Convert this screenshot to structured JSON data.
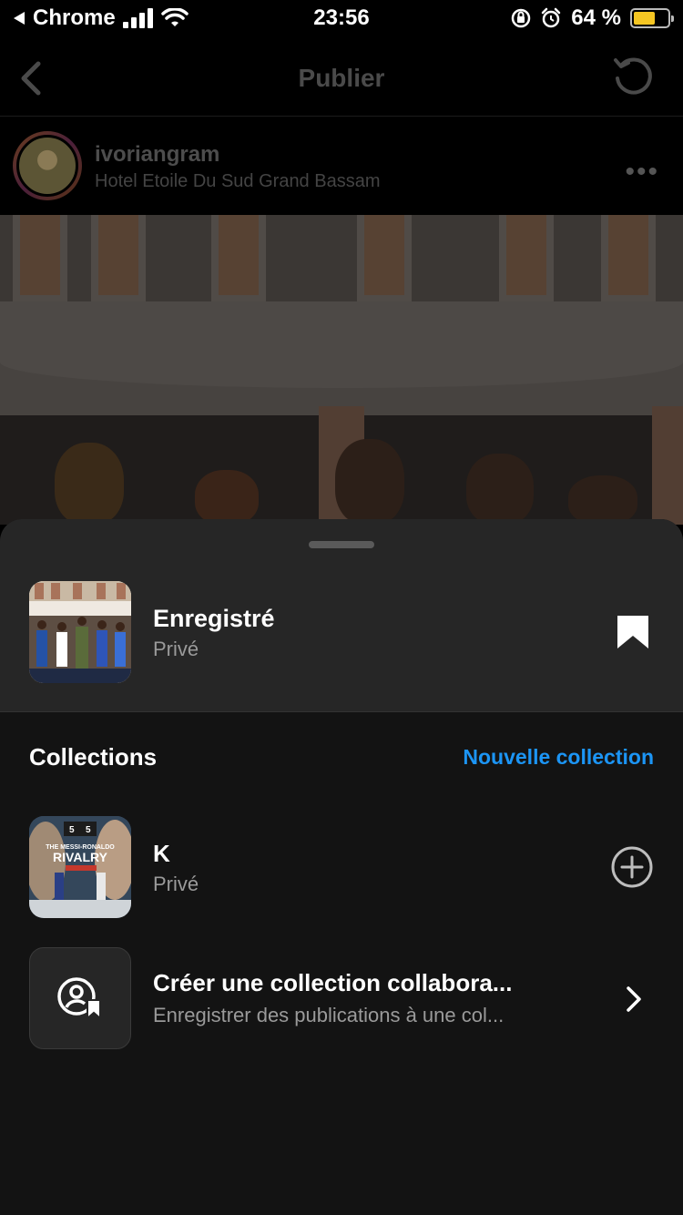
{
  "status_bar": {
    "back_app": "Chrome",
    "time": "23:56",
    "battery_percent": "64 %",
    "battery_level": 0.64,
    "icons": [
      "back-triangle-icon",
      "cellular-signal-icon",
      "wifi-icon",
      "orientation-lock-icon",
      "alarm-icon",
      "battery-icon"
    ]
  },
  "nav": {
    "title": "Publier",
    "back_icon": "chevron-left-icon",
    "refresh_icon": "refresh-icon"
  },
  "post": {
    "username": "ivoriangram",
    "location": "Hotel Etoile Du Sud Grand Bassam",
    "more": "•••"
  },
  "sheet": {
    "saved": {
      "title": "Enregistré",
      "subtitle": "Privé",
      "icon": "bookmark-filled-icon"
    },
    "collections_label": "Collections",
    "new_collection_label": "Nouvelle collection",
    "collections": [
      {
        "title": "K",
        "subtitle": "Privé",
        "action_icon": "plus-circle-icon"
      }
    ],
    "collab": {
      "title": "Créer une collection collabora...",
      "subtitle": "Enregistrer des publications à une col...",
      "icon": "collab-user-bookmark-icon",
      "chevron": "chevron-right-icon"
    },
    "thumb_k_text": {
      "line1": "THE MESSI-RONALDO",
      "line2": "RIVALRY",
      "score_left": "5",
      "score_right": "5"
    }
  },
  "colors": {
    "accent": "#1c95f5",
    "sheet_bg": "#131313",
    "sheet_header_bg": "#262626",
    "muted_text": "#9a9a9a",
    "battery": "#f5c623"
  }
}
